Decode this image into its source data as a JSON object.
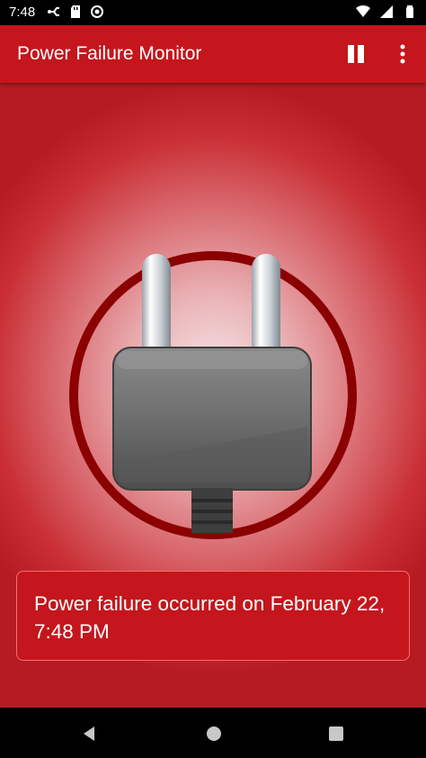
{
  "status_bar": {
    "time": "7:48",
    "left_icons": [
      "usb-debug-icon",
      "sd-card-icon",
      "sync-icon"
    ],
    "right_icons": [
      "wifi-icon",
      "signal-icon",
      "battery-icon"
    ]
  },
  "app_bar": {
    "title": "Power Failure Monitor",
    "actions": [
      "pause-icon",
      "more-vert-icon"
    ]
  },
  "main": {
    "illustration": "power-plug-icon",
    "message": "Power failure occurred on February 22, 7:48 PM"
  },
  "nav_bar": {
    "buttons": [
      "back-icon",
      "home-icon",
      "recents-icon"
    ]
  },
  "colors": {
    "app_bar": "#c4161c",
    "card": "#c4161c",
    "card_border": "#ff6b6b",
    "ring": "#8b0000"
  }
}
